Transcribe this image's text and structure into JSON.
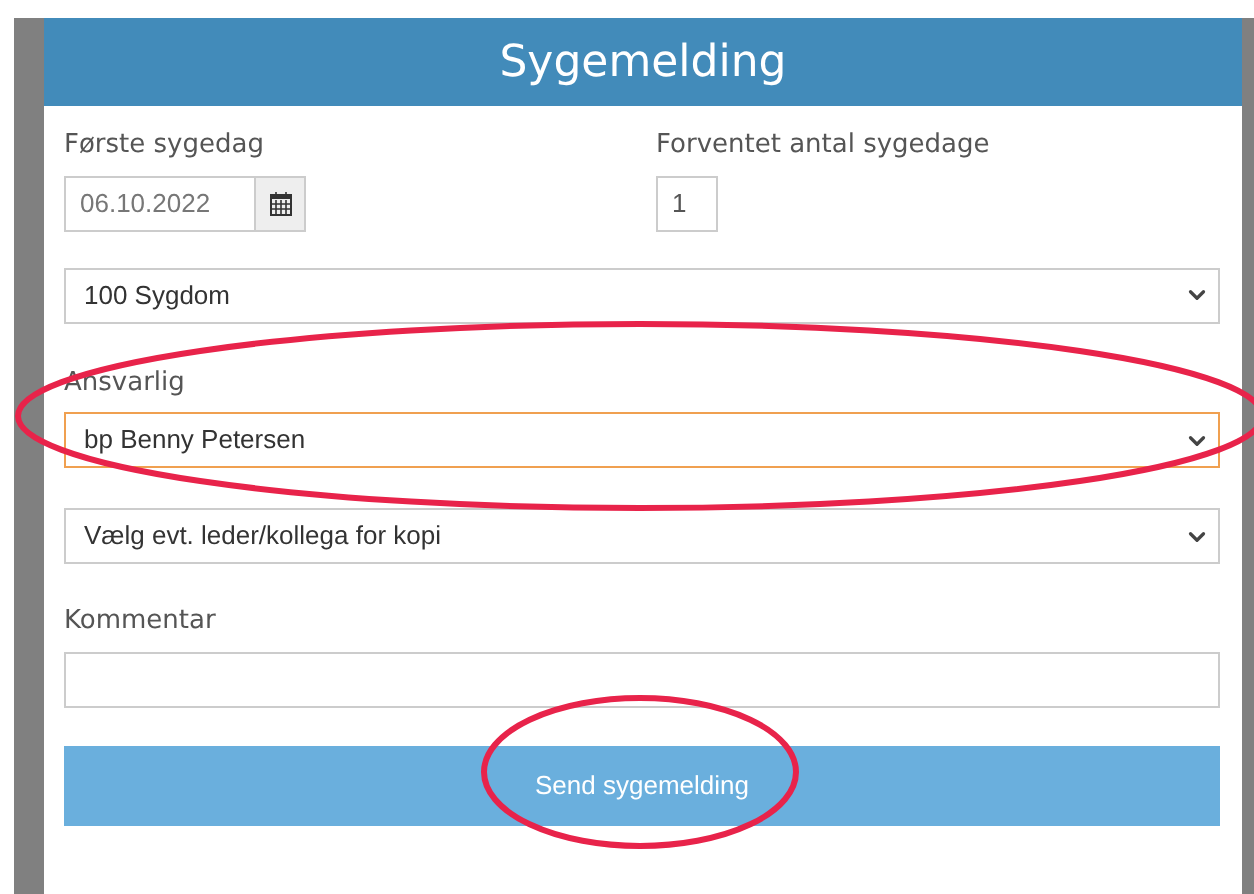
{
  "header": {
    "title": "Sygemelding"
  },
  "fields": [
    {
      "kind": "date",
      "label": "Første sygedag",
      "value": "06.10.2022"
    },
    {
      "kind": "number",
      "label": "Forventet antal sygedage",
      "value": "1"
    }
  ],
  "selects": [
    {
      "value": "100 Sygdom",
      "focused": false
    },
    {
      "label": "Ansvarlig",
      "value": "bp Benny Petersen",
      "focused": true
    },
    {
      "value": "Vælg evt. leder/kollega for kopi",
      "focused": false
    }
  ],
  "comment": {
    "label": "Kommentar"
  },
  "submit": {
    "label": "Send sygemelding"
  }
}
